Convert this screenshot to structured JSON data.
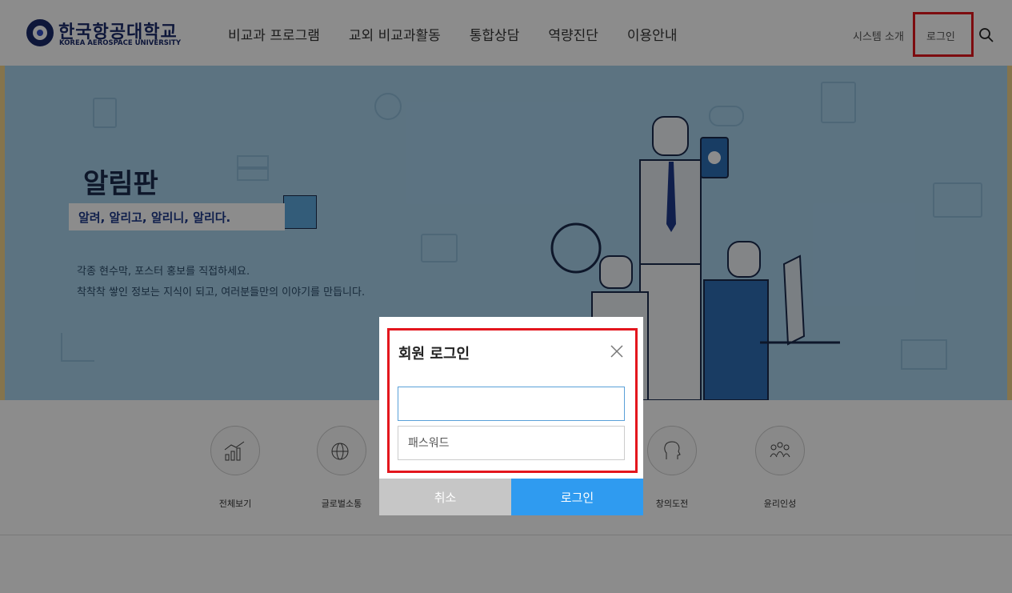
{
  "header": {
    "logo_ko": "한국항공대학교",
    "logo_en": "KOREA AEROSPACE UNIVERSITY",
    "nav": [
      {
        "label": "비교과 프로그램"
      },
      {
        "label": "교외 비교과활동"
      },
      {
        "label": "통합상담"
      },
      {
        "label": "역량진단"
      },
      {
        "label": "이용안내"
      }
    ],
    "util_system": "시스템 소개",
    "util_login": "로그인"
  },
  "hero": {
    "title": "알림판",
    "tag": "알려, 알리고, 알리니, 알리다.",
    "desc1": "각종 현수막, 포스터 홍보를 직접하세요.",
    "desc2": "착착착 쌓인 정보는 지식이 되고, 여러분들만의 이야기를 만듭니다."
  },
  "categories": [
    {
      "label": "전체보기"
    },
    {
      "label": "글로벌소통"
    },
    {
      "label": "창의도전"
    },
    {
      "label": "윤리인성"
    }
  ],
  "modal": {
    "title": "회원 로그인",
    "id_value": "",
    "password_placeholder": "패스워드",
    "cancel": "취소",
    "login": "로그인"
  },
  "colors": {
    "brand_navy": "#1b2a6b",
    "highlight_red": "#e3161d",
    "login_blue": "#2f9bf0",
    "cancel_gray": "#c6c6c6",
    "hero_bg": "#a8d2ec"
  }
}
